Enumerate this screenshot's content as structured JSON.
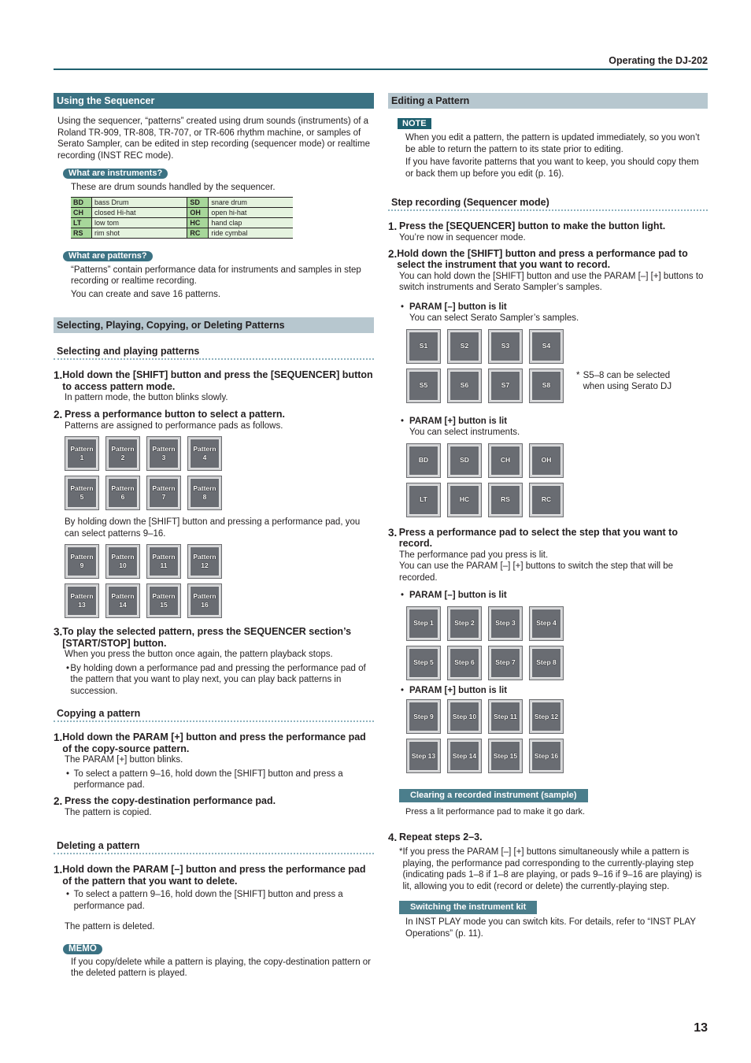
{
  "header": {
    "title": "Operating the DJ-202"
  },
  "page_number": "13",
  "left": {
    "using_sequencer": {
      "title": "Using the Sequencer",
      "body": "Using the sequencer, “patterns” created using drum sounds (instruments) of a Roland TR-909, TR-808, TR-707, or TR-606 rhythm machine, or samples of Serato Sampler, can be edited in step recording (sequencer mode) or realtime recording (INST REC mode).",
      "instruments_pill": "What are instruments?",
      "instruments_intro": "These are drum sounds handled by the sequencer.",
      "instruments_table": [
        {
          "k1": "BD",
          "v1": "bass Drum",
          "k2": "SD",
          "v2": "snare drum"
        },
        {
          "k1": "CH",
          "v1": "closed Hi-hat",
          "k2": "OH",
          "v2": "open hi-hat"
        },
        {
          "k1": "LT",
          "v1": "low tom",
          "k2": "HC",
          "v2": "hand clap"
        },
        {
          "k1": "RS",
          "v1": "rim shot",
          "k2": "RC",
          "v2": "ride cymbal"
        }
      ],
      "patterns_pill": "What are patterns?",
      "patterns_p1": "“Patterns” contain performance data for instruments and samples in step recording or realtime recording.",
      "patterns_p2": "You can create and save 16 patterns."
    },
    "selecting_section": {
      "title": "Selecting, Playing, Copying, or Deleting Patterns",
      "sub1": "Selecting and playing patterns",
      "s1_num": "1.",
      "s1_title": "Hold down the [SHIFT] button and press the [SEQUENCER] button to access pattern mode.",
      "s1_body": "In pattern mode, the button blinks slowly.",
      "s2_num": "2.",
      "s2_title": "Press a performance button to select a pattern.",
      "s2_body": "Patterns are assigned to performance pads as follows.",
      "pads_1_8": [
        "Pattern\n1",
        "Pattern\n2",
        "Pattern\n3",
        "Pattern\n4",
        "Pattern\n5",
        "Pattern\n6",
        "Pattern\n7",
        "Pattern\n8"
      ],
      "s2_body2": "By holding down the [SHIFT] button and pressing a performance pad, you can select patterns 9–16.",
      "pads_9_16": [
        "Pattern\n9",
        "Pattern\n10",
        "Pattern\n11",
        "Pattern\n12",
        "Pattern\n13",
        "Pattern\n14",
        "Pattern\n15",
        "Pattern\n16"
      ],
      "s3_num": "3.",
      "s3_title": "To play the selected pattern, press the SEQUENCER section’s [START/STOP] button.",
      "s3_body": "When you press the button once again, the pattern playback stops.",
      "s3_bullet": "By holding down a performance pad and pressing the performance pad of the pattern that you want to play next, you can play back patterns in succession.",
      "sub2": "Copying a pattern",
      "c1_num": "1.",
      "c1_title": "Hold down the PARAM [+] button and press the performance pad of the copy-source pattern.",
      "c1_body": "The PARAM [+] button blinks.",
      "c1_bullet": "To select a pattern 9–16, hold down the [SHIFT] button and press a performance pad.",
      "c2_num": "2.",
      "c2_title": "Press the copy-destination performance pad.",
      "c2_body": "The pattern is copied.",
      "sub3": "Deleting a pattern",
      "d1_num": "1.",
      "d1_title": "Hold down the PARAM [–] button and press the performance pad of the pattern that you want to delete.",
      "d1_bullet": "To select a pattern 9–16, hold down the [SHIFT] button and press a performance pad.",
      "d1_after": "The pattern is deleted.",
      "memo_tag": "MEMO",
      "memo_body": "If you copy/delete while a pattern is playing, the copy-destination pattern or the deleted pattern is played."
    }
  },
  "right": {
    "editing": {
      "title": "Editing a Pattern",
      "note_tag": "NOTE",
      "note_p1": "When you edit a pattern, the pattern is updated immediately, so you won’t be able to return the pattern to its state prior to editing.",
      "note_p2": "If you have favorite patterns that you want to keep, you should copy them or back them up before you edit (p. 16)."
    },
    "step_rec": {
      "sub": "Step recording (Sequencer mode)",
      "r1_num": "1.",
      "r1_title": "Press the [SEQUENCER] button to make the button light.",
      "r1_body": "You’re now in sequencer mode.",
      "r2_num": "2.",
      "r2_title": "Hold down the [SHIFT] button and press a performance pad to select the instrument that you want to record.",
      "r2_body": "You can hold down the [SHIFT] button and use the PARAM [–] [+] buttons to switch instruments and Serato Sampler’s samples.",
      "minus_lit": "PARAM [–] button is lit",
      "minus_desc": "You can select Serato Sampler’s samples.",
      "sample_pads": [
        "S1",
        "S2",
        "S3",
        "S4",
        "S5",
        "S6",
        "S7",
        "S8"
      ],
      "sample_note": "S5–8 can be selected when using Serato DJ",
      "plus_lit": "PARAM [+] button is lit",
      "plus_desc": "You can select instruments.",
      "inst_pads": [
        "BD",
        "SD",
        "CH",
        "OH",
        "LT",
        "HC",
        "RS",
        "RC"
      ],
      "r3_num": "3.",
      "r3_title": "Press a performance pad to select the step that you want to record.",
      "r3_body1": "The performance pad you press is lit.",
      "r3_body2": "You can use the PARAM [–] [+] buttons to switch the step that will be recorded.",
      "r3_minus": "PARAM [–] button is lit",
      "steps_1_8": [
        "Step 1",
        "Step 2",
        "Step 3",
        "Step 4",
        "Step 5",
        "Step 6",
        "Step 7",
        "Step 8"
      ],
      "r3_plus": "PARAM [+] button is lit",
      "steps_9_16": [
        "Step 9",
        "Step 10",
        "Step 11",
        "Step 12",
        "Step 13",
        "Step 14",
        "Step 15",
        "Step 16"
      ],
      "clear_bar": "Clearing a recorded instrument (sample)",
      "clear_body": "Press a lit performance pad to make it go dark.",
      "r4_num": "4.",
      "r4_title": "Repeat steps 2–3.",
      "r4_note": "If you press the PARAM [–] [+] buttons simultaneously while a pattern is playing, the performance pad corresponding to the currently-playing step (indicating pads 1–8 if 1–8 are playing, or pads 9–16 if 9–16 are playing) is lit, allowing you to edit (record or delete) the currently-playing step.",
      "kit_bar": "Switching the instrument kit",
      "kit_body": "In INST PLAY mode you can switch kits. For details, refer to “INST PLAY Operations” (p. 11)."
    }
  }
}
